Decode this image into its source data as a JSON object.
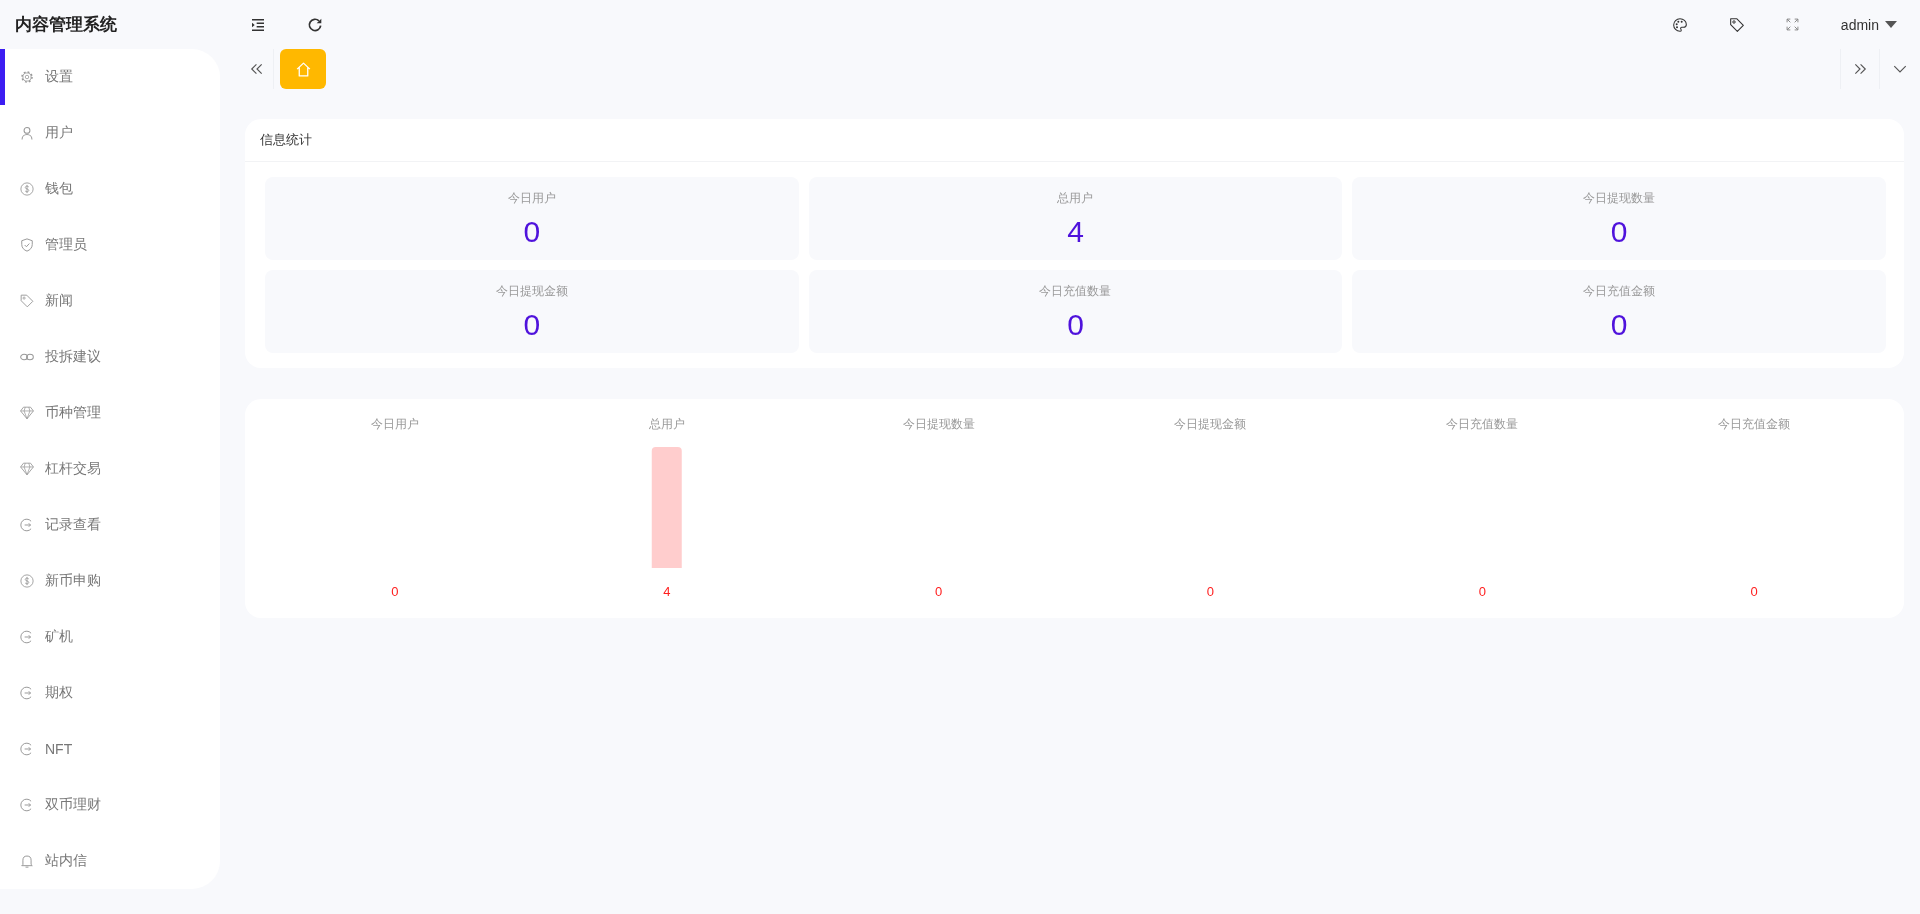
{
  "header": {
    "title": "内容管理系统",
    "user": "admin"
  },
  "sidebar": {
    "items": [
      {
        "label": "设置",
        "selected": true
      },
      {
        "label": "用户",
        "selected": false
      },
      {
        "label": "钱包",
        "selected": false
      },
      {
        "label": "管理员",
        "selected": false
      },
      {
        "label": "新闻",
        "selected": false
      },
      {
        "label": "投拆建议",
        "selected": false
      },
      {
        "label": "币种管理",
        "selected": false
      },
      {
        "label": "杠杆交易",
        "selected": false
      },
      {
        "label": "记录查看",
        "selected": false
      },
      {
        "label": "新币申购",
        "selected": false
      },
      {
        "label": "矿机",
        "selected": false
      },
      {
        "label": "期权",
        "selected": false
      },
      {
        "label": "NFT",
        "selected": false
      },
      {
        "label": "双币理财",
        "selected": false
      },
      {
        "label": "站内信",
        "selected": false
      }
    ]
  },
  "tabs": [
    {
      "selected": true
    }
  ],
  "stats": {
    "title": "信息统计",
    "items": [
      {
        "label": "今日用户",
        "value": "0"
      },
      {
        "label": "总用户",
        "value": "4"
      },
      {
        "label": "今日提现数量",
        "value": "0"
      },
      {
        "label": "今日提现金额",
        "value": "0"
      },
      {
        "label": "今日充值数量",
        "value": "0"
      },
      {
        "label": "今日充值金额",
        "value": "0"
      }
    ]
  },
  "chart": {
    "chart_data": {
      "type": "bar",
      "categories": [
        "今日用户",
        "总用户",
        "今日提现数量",
        "今日提现金额",
        "今日充值数量",
        "今日充值金额"
      ],
      "values": [
        0,
        4,
        0,
        0,
        0,
        0
      ],
      "data_labels": true
    }
  }
}
